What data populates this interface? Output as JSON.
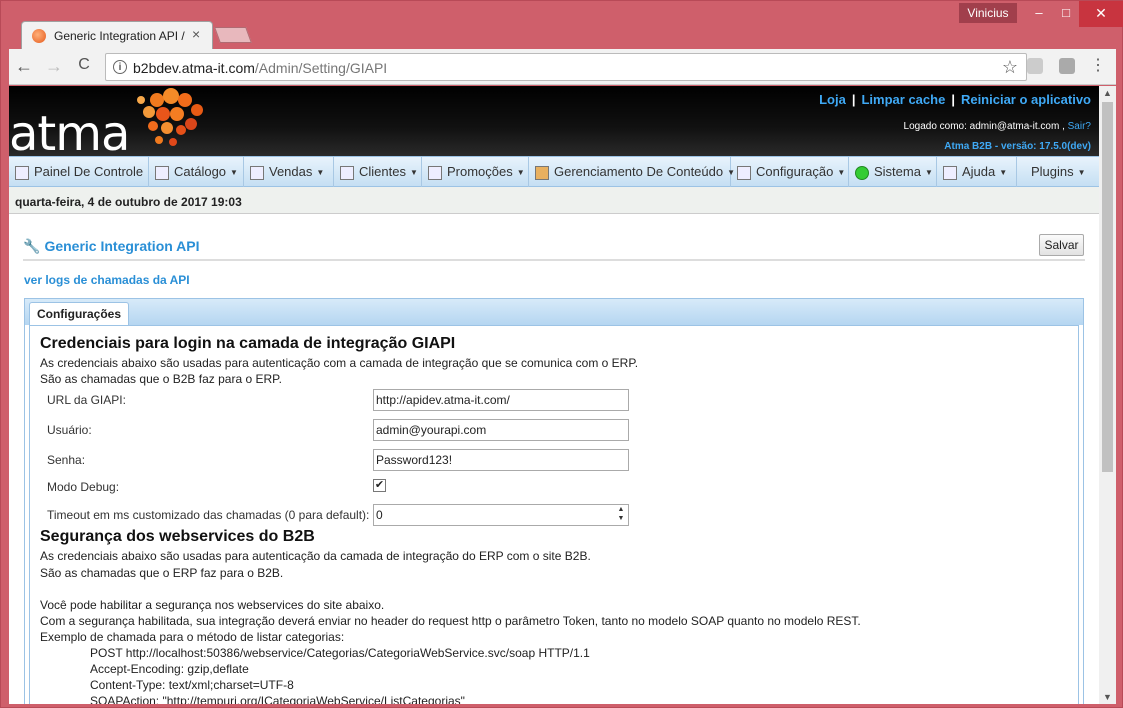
{
  "window": {
    "user": "Vinicius",
    "controls": [
      "–",
      "□",
      "✕"
    ]
  },
  "tab": {
    "title": "Generic Integration API /",
    "close": "×"
  },
  "toolbar": {
    "back": "←",
    "forward": "→",
    "reload": "C",
    "info": "i",
    "url_host": "b2bdev.atma-it.com",
    "url_path": "/Admin/Setting/GIAPI",
    "star": "☆",
    "menu": "⋮"
  },
  "header": {
    "logo": "atma",
    "links": [
      "Loja",
      "Limpar cache",
      "Reiniciar o aplicativo"
    ],
    "separator": "|",
    "logged_label": "Logado como: admin@atma-it.com ,",
    "logout": "Sair?",
    "version": "Atma B2B - versão: 17.5.0(dev)"
  },
  "menu": [
    {
      "label": "Painel De Controle",
      "dropdown": false
    },
    {
      "label": "Catálogo",
      "dropdown": true
    },
    {
      "label": "Vendas",
      "dropdown": true
    },
    {
      "label": "Clientes",
      "dropdown": true
    },
    {
      "label": "Promoções",
      "dropdown": true
    },
    {
      "label": "Gerenciamento De Conteúdo",
      "dropdown": true
    },
    {
      "label": "Configuração",
      "dropdown": true
    },
    {
      "label": "Sistema",
      "dropdown": true
    },
    {
      "label": "Ajuda",
      "dropdown": true
    },
    {
      "label": "Plugins",
      "dropdown": true
    }
  ],
  "date": "quarta-feira, 4 de outubro de 2017 19:03",
  "page": {
    "title": "Generic Integration API",
    "save": "Salvar",
    "log_link": "ver logs de chamadas da API",
    "tab": "Configurações"
  },
  "section1": {
    "heading": "Credenciais para login na camada de integração GIAPI",
    "desc1": "As credenciais abaixo são usadas para autenticação com a camada de integração que se comunica com o ERP.",
    "desc2": "São as chamadas que o B2B faz para o ERP.",
    "url_label": "URL da GIAPI:",
    "url_value": "http://apidev.atma-it.com/",
    "user_label": "Usuário:",
    "user_value": "admin@yourapi.com",
    "pass_label": "Senha:",
    "pass_value": "Password123!",
    "debug_label": "Modo Debug:",
    "debug_checked": "✔",
    "timeout_label": "Timeout em ms customizado das chamadas (0 para default):",
    "timeout_value": "0"
  },
  "section2": {
    "heading": "Segurança dos webservices do B2B",
    "desc1": "As credenciais abaixo são usadas para autenticação da camada de integração do ERP com o site B2B.",
    "desc2": "São as chamadas que o ERP faz para o B2B.",
    "desc3": "Você pode habilitar a segurança nos webservices do site abaixo.",
    "desc4": "Com a segurança habilitada, sua integração deverá enviar no header do request http o parâmetro Token, tanto no modelo SOAP quanto no modelo REST.",
    "desc5": "Exemplo de chamada para o método de listar categorias:",
    "code": [
      "POST http://localhost:50386/webservice/Categorias/CategoriaWebService.svc/soap HTTP/1.1",
      "Accept-Encoding: gzip,deflate",
      "Content-Type: text/xml;charset=UTF-8",
      "SOAPAction: \"http://tempuri.org/ICategoriaWebService/ListCategorias\""
    ]
  }
}
